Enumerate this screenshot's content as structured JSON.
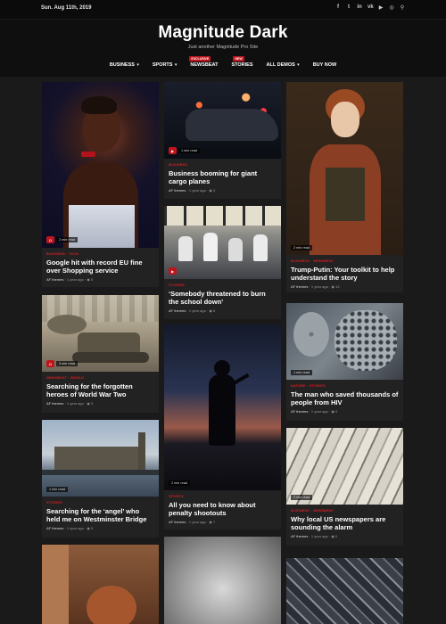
{
  "topbar": {
    "date": "Sun. Aug 11th, 2019",
    "social_icons": [
      {
        "icon": "facebook-icon",
        "glyph": "f"
      },
      {
        "icon": "twitter-icon",
        "glyph": "t"
      },
      {
        "icon": "linkedin-icon",
        "glyph": "in"
      },
      {
        "icon": "vk-icon",
        "glyph": "vk"
      },
      {
        "icon": "youtube-icon",
        "glyph": "▶"
      },
      {
        "icon": "instagram-icon",
        "glyph": "◎"
      },
      {
        "icon": "search-icon",
        "glyph": "⚲"
      }
    ]
  },
  "header": {
    "site_title": "Magnitude Dark",
    "tagline": "Just another Magnitude Pro Site"
  },
  "nav": {
    "items": [
      {
        "label": "BUSINESS",
        "dropdown": true,
        "badge": ""
      },
      {
        "label": "SPORTS",
        "dropdown": true,
        "badge": ""
      },
      {
        "label": "NEWSBEAT",
        "dropdown": false,
        "badge": "EXCLUSIVE"
      },
      {
        "label": "STORIES",
        "dropdown": false,
        "badge": "NEW"
      },
      {
        "label": "ALL DEMOS",
        "dropdown": true,
        "badge": ""
      },
      {
        "label": "BUY NOW",
        "dropdown": false,
        "badge": ""
      }
    ]
  },
  "colors": {
    "accent": "#c0141d",
    "background": "#1a1a1a",
    "card": "#222222"
  },
  "cards": [
    {
      "col": 1,
      "category": "BUSINESS · TECH",
      "title": "Google hit with record EU fine over Shopping service",
      "author": "AF themes",
      "time": "1 year ago",
      "views": "5",
      "read": "2 min read",
      "media": "camera-icon"
    },
    {
      "col": 1,
      "category": "NEWSBEAT · WORLD",
      "title": "Searching for the forgotten heroes of World War Two",
      "author": "AF themes",
      "time": "1 year ago",
      "views": "0",
      "read": "3 min read",
      "media": "camera-icon"
    },
    {
      "col": 1,
      "category": "STORIES",
      "title": "Searching for the ‘angel’ who held me on Westminster Bridge",
      "author": "AF themes",
      "time": "1 year ago",
      "views": "0",
      "read": "1 min read",
      "media": ""
    },
    {
      "col": 2,
      "category": "BUSINESS",
      "title": "Business booming for giant cargo planes",
      "author": "AF themes",
      "time": "1 year ago",
      "views": "3",
      "read": "1 min read",
      "media": "video-icon"
    },
    {
      "col": 2,
      "category": "STORIES",
      "title": "‘Somebody threatened to burn the school down’",
      "author": "AF themes",
      "time": "1 year ago",
      "views": "6",
      "read": "",
      "media": "video-icon"
    },
    {
      "col": 2,
      "category": "SPORTS",
      "title": "All you need to know about penalty shootouts",
      "author": "AF themes",
      "time": "1 year ago",
      "views": "7",
      "read": "2 min read",
      "media": ""
    },
    {
      "col": 3,
      "category": "BUSINESS · NEWSBEAT",
      "title": "Trump-Putin: Your toolkit to help understand the story",
      "author": "AF themes",
      "time": "1 year ago",
      "views": "13",
      "read": "2 min read",
      "media": ""
    },
    {
      "col": 3,
      "category": "NATURE · STORIES",
      "title": "The man who saved thousands of people from HIV",
      "author": "AF themes",
      "time": "1 year ago",
      "views": "0",
      "read": "1 min read",
      "media": ""
    },
    {
      "col": 3,
      "category": "BUSINESS · NEWSBEAT",
      "title": "Why local US newspapers are sounding the alarm",
      "author": "AF themes",
      "time": "1 year ago",
      "views": "0",
      "read": "2 min read",
      "media": ""
    }
  ]
}
